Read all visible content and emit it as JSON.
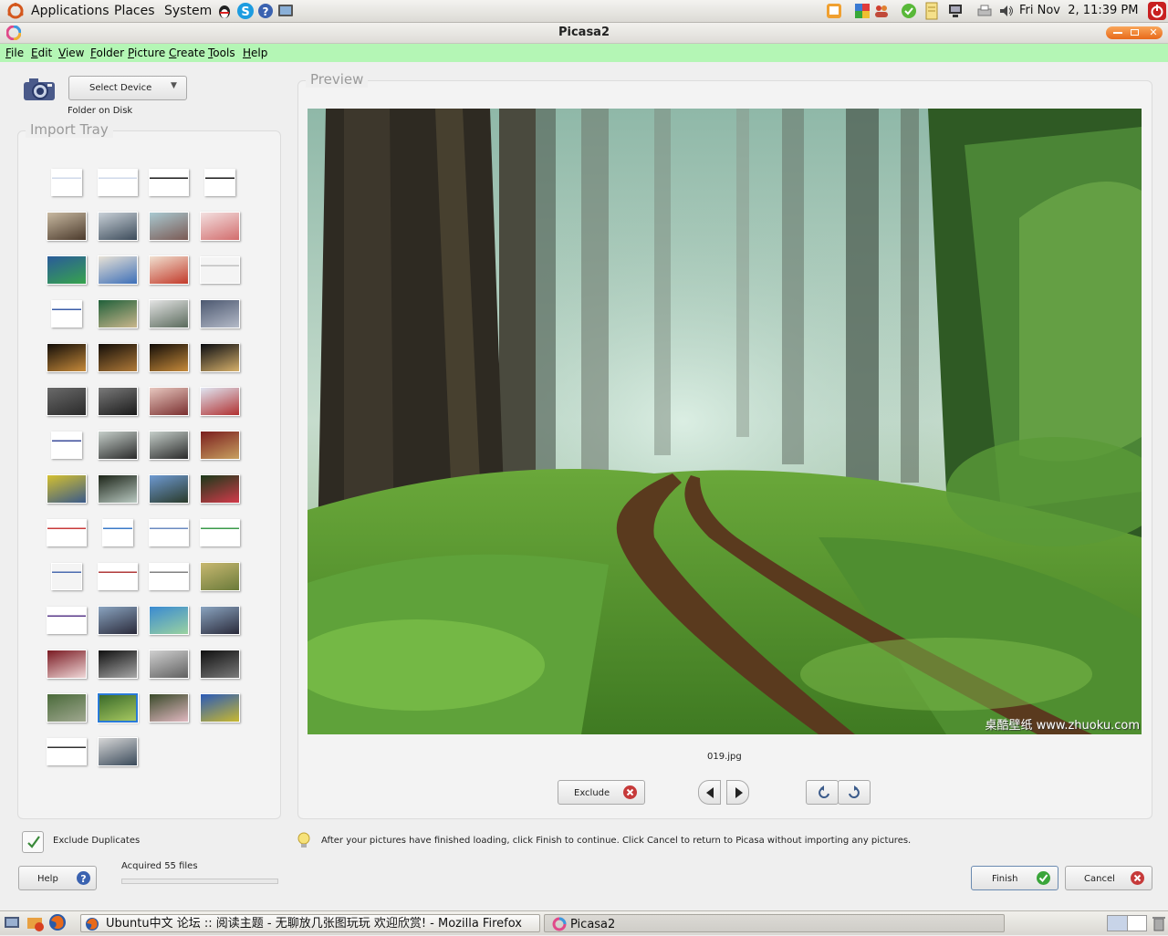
{
  "top_panel": {
    "menus": [
      "Applications",
      "Places",
      "System"
    ],
    "clock": "Fri Nov  2, 11:39 PM"
  },
  "window": {
    "title": "Picasa2"
  },
  "menubar": {
    "items": [
      {
        "label": "File",
        "underline": "F",
        "rest": "ile"
      },
      {
        "label": "Edit",
        "underline": "E",
        "rest": "dit"
      },
      {
        "label": "View",
        "underline": "V",
        "rest": "iew"
      },
      {
        "label": "Folder",
        "underline": "F",
        "rest": "older"
      },
      {
        "label": "Picture",
        "underline": "P",
        "rest": "icture"
      },
      {
        "label": "Create",
        "underline": "C",
        "rest": "reate"
      },
      {
        "label": "Tools",
        "underline": "T",
        "rest": "ools"
      },
      {
        "label": "Help",
        "underline": "H",
        "rest": "elp"
      }
    ]
  },
  "left": {
    "select_device": "Select Device",
    "folder_on_disk": "Folder on Disk",
    "import_tray_title": "Import Tray",
    "exclude_duplicates": "Exclude Duplicates",
    "help_button": "Help",
    "acquired": "Acquired 55 files"
  },
  "preview": {
    "title": "Preview",
    "filename": "019.jpg",
    "watermark": "桌酷壁纸 www.zhuoku.com",
    "exclude_button": "Exclude",
    "hint": "After your pictures have finished loading, click Finish to continue. Click Cancel to return to Picasa without importing any pictures."
  },
  "footer": {
    "finish": "Finish",
    "cancel": "Cancel"
  },
  "taskbar": {
    "tasks": [
      "Ubuntu中文 论坛 :: 阅读主题 - 无聊放几张图玩玩 欢迎欣赏! - Mozilla Firefox",
      "Picasa2"
    ]
  },
  "colors": {
    "menubar": "#b4f6b5",
    "finish_check": "#3aa53a",
    "cancel_x": "#c63a3a"
  },
  "thumbnails": [
    {
      "kind": "doc",
      "colors": [
        "#ffffff",
        "#cfd8ea"
      ]
    },
    {
      "kind": "doc",
      "colors": [
        "#ffffff",
        "#cfd8ea"
      ]
    },
    {
      "kind": "doc",
      "colors": [
        "#ffffff",
        "#1a1a1a"
      ]
    },
    {
      "kind": "doc",
      "colors": [
        "#ffffff",
        "#1a1a1a"
      ]
    },
    {
      "kind": "photo",
      "colors": [
        "#c8b9a1",
        "#4b3a2c"
      ]
    },
    {
      "kind": "photo",
      "colors": [
        "#c9d1d8",
        "#3c4b5a"
      ]
    },
    {
      "kind": "photo",
      "colors": [
        "#a9c9d1",
        "#7b5a54"
      ]
    },
    {
      "kind": "photo",
      "colors": [
        "#f3e0e0",
        "#d26d6d"
      ]
    },
    {
      "kind": "photo",
      "colors": [
        "#2a5b9a",
        "#37a34d"
      ]
    },
    {
      "kind": "photo",
      "colors": [
        "#e8e2d6",
        "#3d6fb8"
      ]
    },
    {
      "kind": "photo",
      "colors": [
        "#f0e0d0",
        "#c23a2a"
      ]
    },
    {
      "kind": "doc",
      "colors": [
        "#f4f4f4",
        "#c0c0c0"
      ]
    },
    {
      "kind": "doc",
      "colors": [
        "#ffffff",
        "#3a5ca8"
      ]
    },
    {
      "kind": "photo",
      "colors": [
        "#20603a",
        "#c9b68c"
      ]
    },
    {
      "kind": "photo",
      "colors": [
        "#e4e4e4",
        "#5a6a5c"
      ]
    },
    {
      "kind": "photo",
      "colors": [
        "#4c5870",
        "#b4bac8"
      ]
    },
    {
      "kind": "photo",
      "colors": [
        "#120d08",
        "#c68a3a"
      ]
    },
    {
      "kind": "photo",
      "colors": [
        "#120d08",
        "#b07a38"
      ]
    },
    {
      "kind": "photo",
      "colors": [
        "#120d08",
        "#c68a3a"
      ]
    },
    {
      "kind": "photo",
      "colors": [
        "#0a0c12",
        "#d6b06a"
      ]
    },
    {
      "kind": "photo",
      "colors": [
        "#6a6a6a",
        "#2a2a2a"
      ]
    },
    {
      "kind": "photo",
      "colors": [
        "#7a7a7a",
        "#1a1a1a"
      ]
    },
    {
      "kind": "photo",
      "colors": [
        "#e8c8c0",
        "#7a2f2f"
      ]
    },
    {
      "kind": "photo",
      "colors": [
        "#e0e6f2",
        "#b03030"
      ]
    },
    {
      "kind": "doc",
      "colors": [
        "#ffffff",
        "#3a4b9a"
      ]
    },
    {
      "kind": "photo",
      "colors": [
        "#c6cfca",
        "#2a2a2a"
      ]
    },
    {
      "kind": "photo",
      "colors": [
        "#c6cfca",
        "#2a2a2a"
      ]
    },
    {
      "kind": "photo",
      "colors": [
        "#7a1e1e",
        "#c8a060"
      ]
    },
    {
      "kind": "photo",
      "colors": [
        "#d4c030",
        "#3a5a8a"
      ]
    },
    {
      "kind": "photo",
      "colors": [
        "#1c2418",
        "#b8c8c0"
      ]
    },
    {
      "kind": "photo",
      "colors": [
        "#6e9ad2",
        "#2a3a2a"
      ]
    },
    {
      "kind": "photo",
      "colors": [
        "#1a3a1a",
        "#d23a4a"
      ]
    },
    {
      "kind": "doc",
      "colors": [
        "#ffffff",
        "#c83a3a"
      ]
    },
    {
      "kind": "doc",
      "colors": [
        "#ffffff",
        "#3a7ac8"
      ]
    },
    {
      "kind": "doc",
      "colors": [
        "#ffffff",
        "#6a8ac0"
      ]
    },
    {
      "kind": "doc",
      "colors": [
        "#ffffff",
        "#3a9a4a"
      ]
    },
    {
      "kind": "doc",
      "colors": [
        "#f4f4f4",
        "#4a6ab0"
      ]
    },
    {
      "kind": "doc",
      "colors": [
        "#ffffff",
        "#b03a3a"
      ]
    },
    {
      "kind": "doc",
      "colors": [
        "#ffffff",
        "#808080"
      ]
    },
    {
      "kind": "photo",
      "colors": [
        "#c8b870",
        "#6a7a3a"
      ]
    },
    {
      "kind": "doc",
      "colors": [
        "#ffffff",
        "#5a3a8a"
      ]
    },
    {
      "kind": "photo",
      "colors": [
        "#8aa4c0",
        "#2a2a3a"
      ]
    },
    {
      "kind": "photo",
      "colors": [
        "#3a8ad2",
        "#9ad2a0"
      ]
    },
    {
      "kind": "photo",
      "colors": [
        "#8aa4c0",
        "#2a2a3a"
      ]
    },
    {
      "kind": "photo",
      "colors": [
        "#7a1a22",
        "#f0d8d8"
      ]
    },
    {
      "kind": "photo",
      "colors": [
        "#101010",
        "#a8a8a8"
      ]
    },
    {
      "kind": "photo",
      "colors": [
        "#d0d0d0",
        "#606060"
      ]
    },
    {
      "kind": "photo",
      "colors": [
        "#101010",
        "#7a7a7a"
      ]
    },
    {
      "kind": "photo",
      "colors": [
        "#4a6a3a",
        "#a0a890"
      ]
    },
    {
      "kind": "photo",
      "colors": [
        "#3a6a2a",
        "#a6c860"
      ],
      "selected": true
    },
    {
      "kind": "photo",
      "colors": [
        "#3a4a2a",
        "#e0b8c0"
      ]
    },
    {
      "kind": "photo",
      "colors": [
        "#2a5ab8",
        "#c8b830"
      ]
    },
    {
      "kind": "doc",
      "colors": [
        "#ffffff",
        "#303030"
      ]
    },
    {
      "kind": "photo",
      "colors": [
        "#d8d8d8",
        "#3a4a5a"
      ]
    }
  ]
}
